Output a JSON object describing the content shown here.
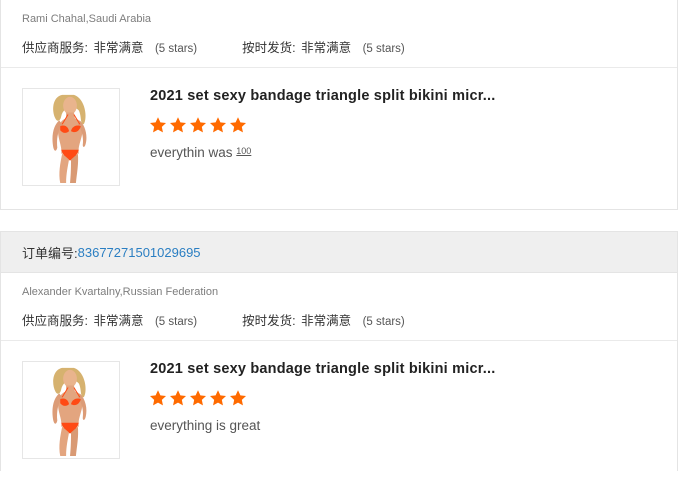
{
  "reviews": [
    {
      "buyer": "Rami Chahal,Saudi Arabia",
      "supplier_service_label": "供应商服务:",
      "supplier_service_value": "非常满意",
      "supplier_service_stars": "(5 stars)",
      "shipping_label": "按时发货:",
      "shipping_value": "非常满意",
      "shipping_stars": "(5 stars)",
      "product_title": "2021 set sexy bandage triangle split bikini micr...",
      "rating": 5,
      "review_text": "everythin was ",
      "review_sup": "100"
    },
    {
      "order_label": "订单编号: ",
      "order_number": "83677271501029695",
      "buyer": "Alexander Kvartalny,Russian Federation",
      "supplier_service_label": "供应商服务:",
      "supplier_service_value": "非常满意",
      "supplier_service_stars": "(5 stars)",
      "shipping_label": "按时发货:",
      "shipping_value": "非常满意",
      "shipping_stars": "(5 stars)",
      "product_title": "2021 set sexy bandage triangle split bikini micr...",
      "rating": 5,
      "review_text": "everything is great"
    }
  ],
  "colors": {
    "star": "#ff6a00",
    "order_link": "#2a7ec2",
    "bar_bg": "#efefef"
  }
}
